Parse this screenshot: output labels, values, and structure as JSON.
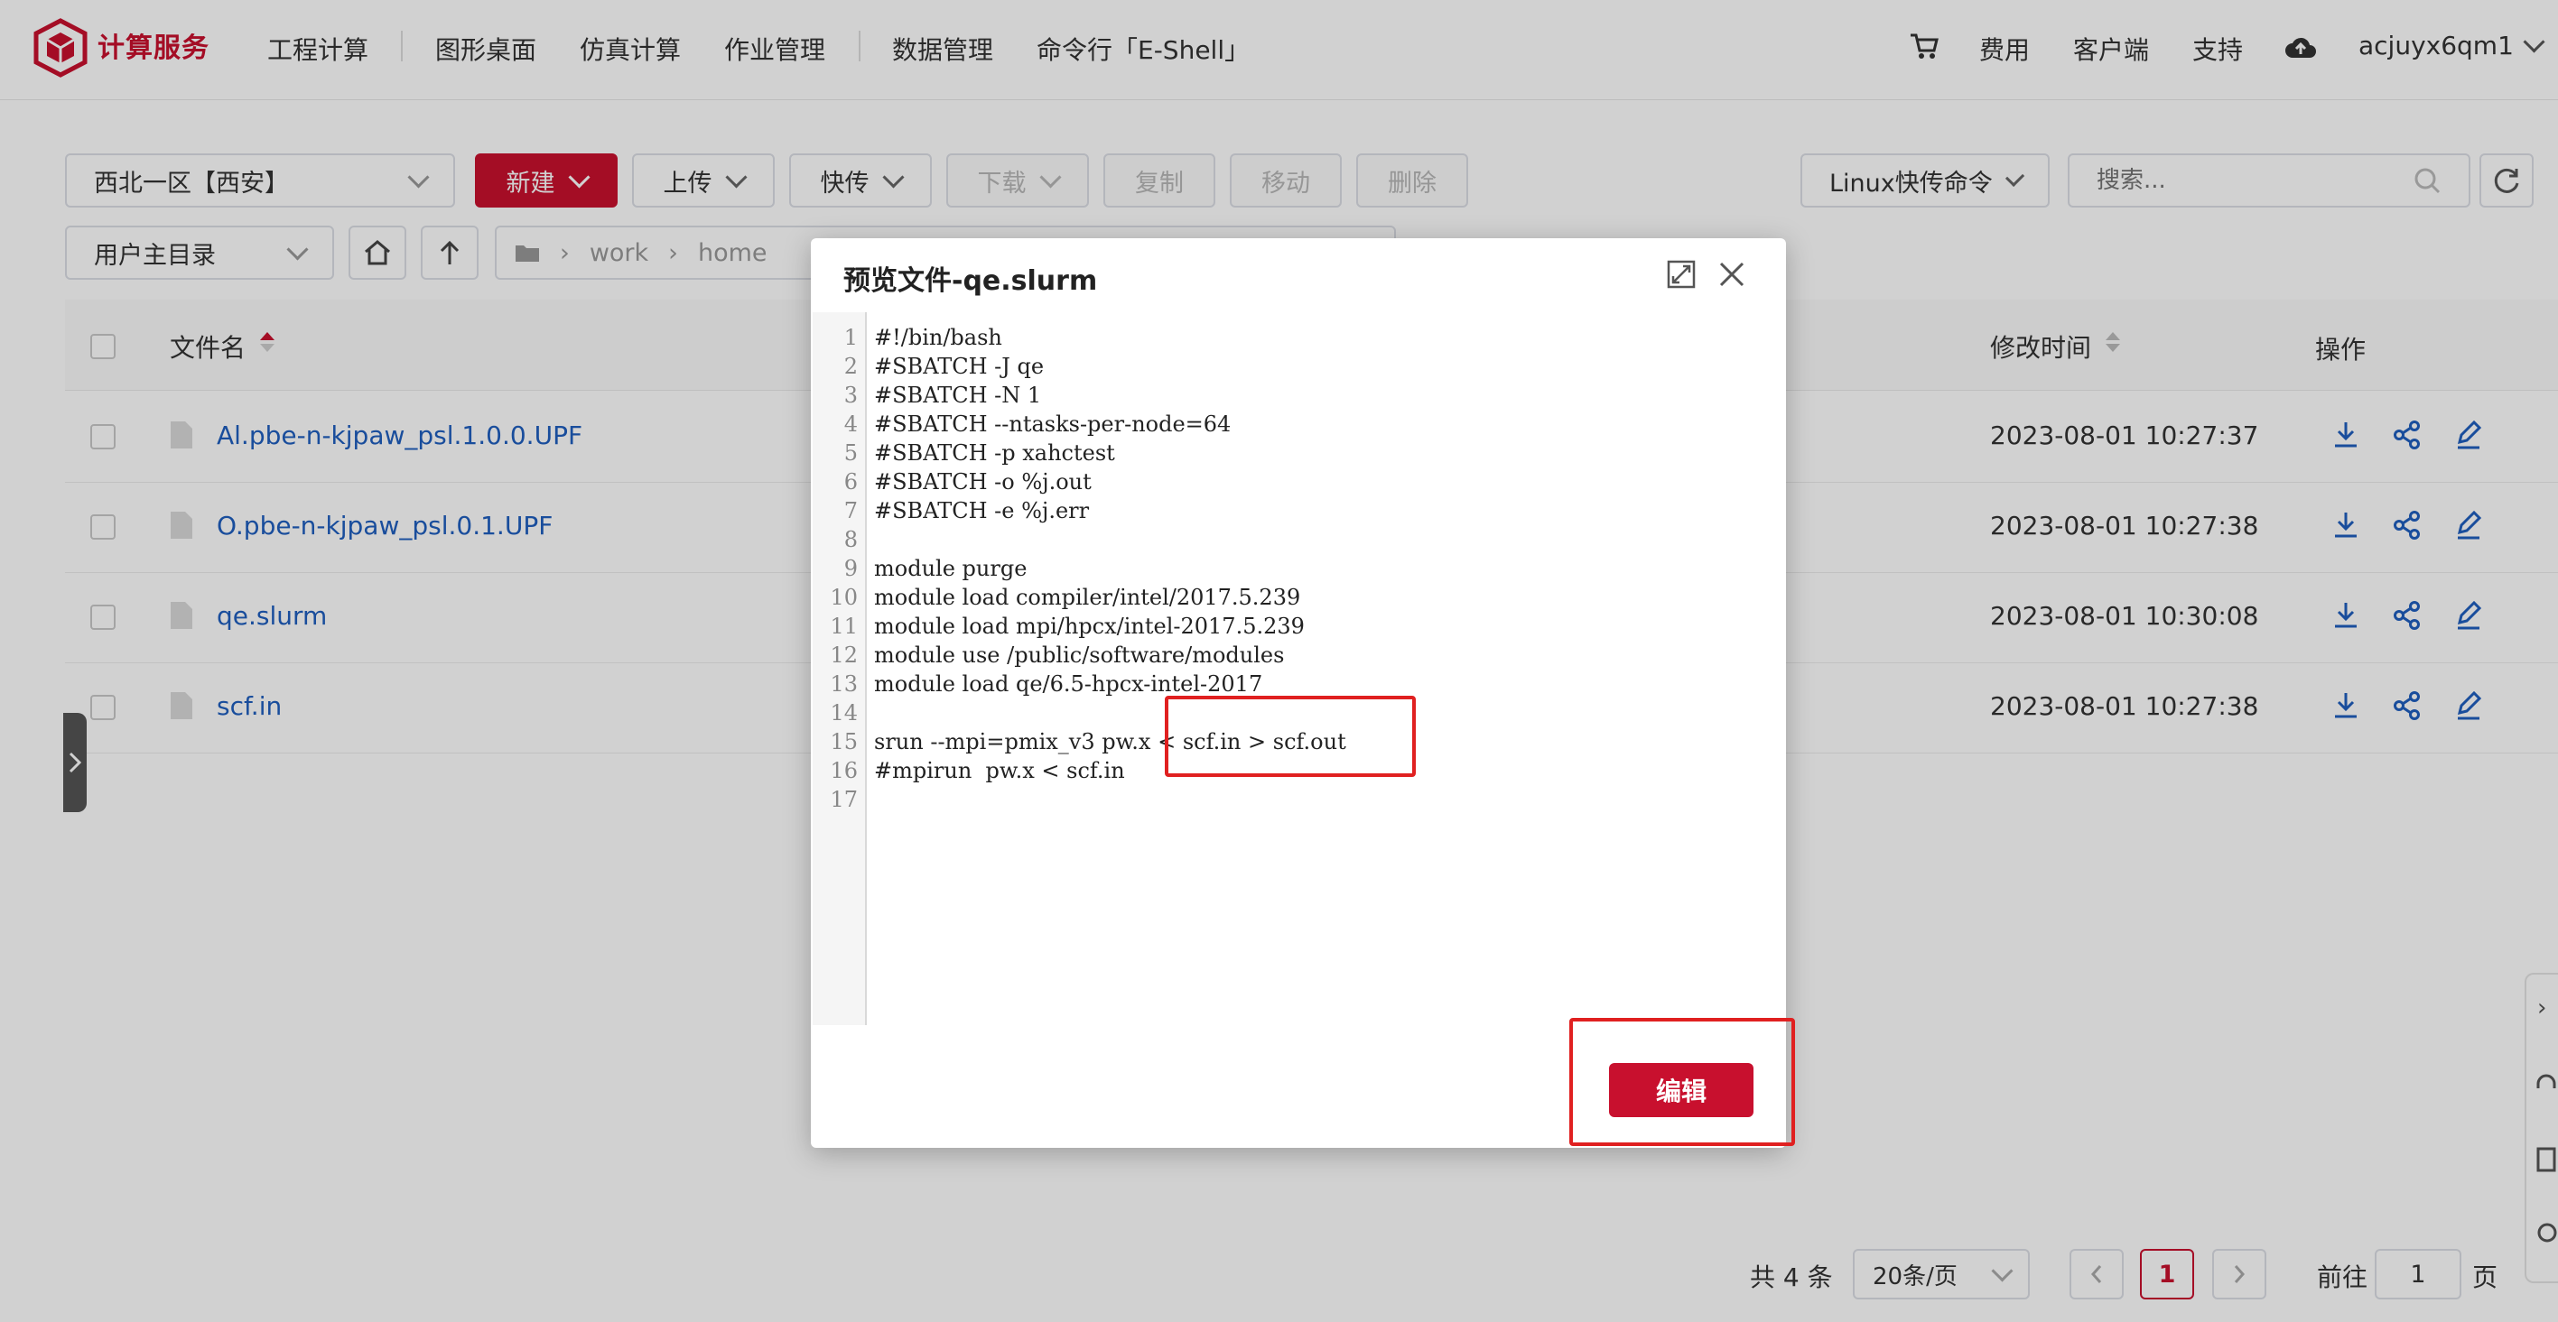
{
  "nav": {
    "brand": "计算服务",
    "items": [
      "工程计算",
      "图形桌面",
      "仿真计算",
      "作业管理",
      "数据管理",
      "命令行「E-Shell」"
    ],
    "right": {
      "fee": "费用",
      "client": "客户端",
      "support": "支持",
      "user": "acjuyx6qm1"
    }
  },
  "toolbar": {
    "region": "西北一区【西安】",
    "new_label": "新建",
    "upload_label": "上传",
    "fast_label": "快传",
    "download_label": "下载",
    "copy_label": "复制",
    "move_label": "移动",
    "delete_label": "删除",
    "linux_cmd": "Linux快传命令",
    "search_placeholder": "搜索..."
  },
  "pathbar": {
    "dir_select": "用户主目录",
    "crumbs": [
      "work",
      "home"
    ]
  },
  "table": {
    "headers": {
      "name": "文件名",
      "mtime": "修改时间",
      "ops": "操作"
    },
    "rows": [
      {
        "name": "Al.pbe-n-kjpaw_psl.1.0.0.UPF",
        "mtime": "2023-08-01 10:27:37"
      },
      {
        "name": "O.pbe-n-kjpaw_psl.0.1.UPF",
        "mtime": "2023-08-01 10:27:38"
      },
      {
        "name": "qe.slurm",
        "mtime": "2023-08-01 10:30:08"
      },
      {
        "name": "scf.in",
        "mtime": "2023-08-01 10:27:38"
      }
    ]
  },
  "pagination": {
    "total": "共 4 条",
    "page_size": "20条/页",
    "current": "1",
    "goto_prefix": "前往",
    "goto_value": "1",
    "goto_suffix": "页"
  },
  "modal": {
    "title": "预览文件-qe.slurm",
    "edit_label": "编辑",
    "lines": [
      "#!/bin/bash",
      "#SBATCH -J qe",
      "#SBATCH -N 1",
      "#SBATCH --ntasks-per-node=64",
      "#SBATCH -p xahctest",
      "#SBATCH -o %j.out",
      "#SBATCH -e %j.err",
      "",
      "module purge",
      "module load compiler/intel/2017.5.239",
      "module load mpi/hpcx/intel-2017.5.239",
      "module use /public/software/modules",
      "module load qe/6.5-hpcx-intel-2017",
      "",
      "srun --mpi=pmix_v3 pw.x < scf.in > scf.out",
      "#mpirun  pw.x < scf.in",
      ""
    ]
  },
  "colors": {
    "brand": "#c8102e",
    "link": "#1f5fbf",
    "highlight": "#e02020"
  }
}
